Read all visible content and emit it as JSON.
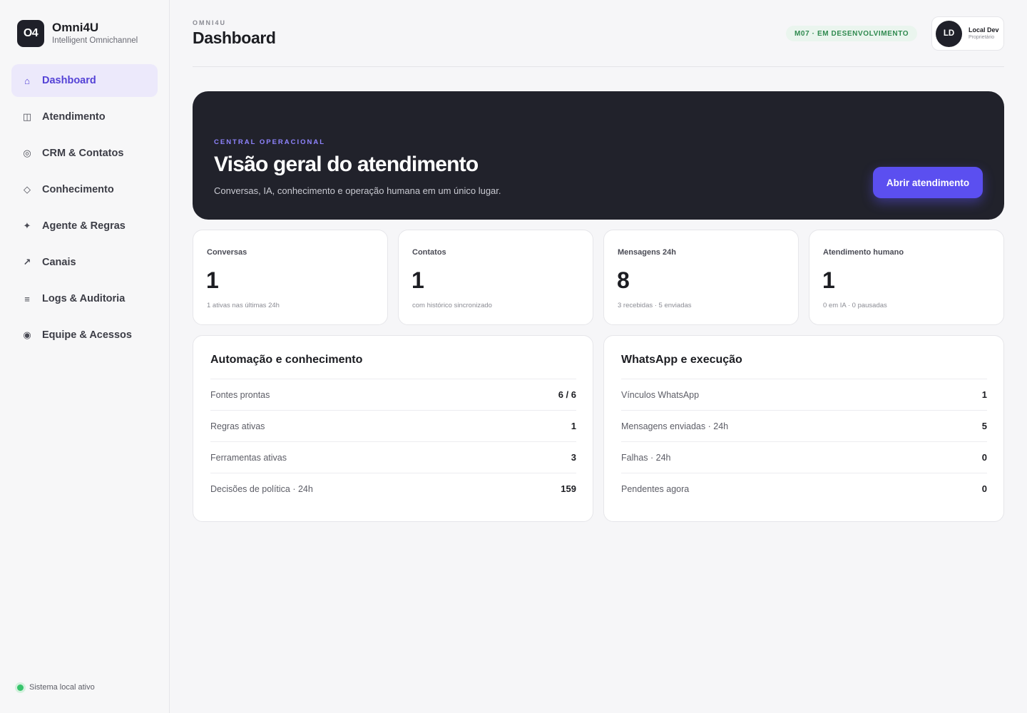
{
  "brand": {
    "logo": "O4",
    "name": "Omni4U",
    "subtitle": "Intelligent Omnichannel"
  },
  "sidebar": {
    "items": [
      {
        "label": "Dashboard",
        "icon": "home-icon",
        "glyph": "⌂",
        "active": true
      },
      {
        "label": "Atendimento",
        "icon": "columns-icon",
        "glyph": "◫",
        "active": false
      },
      {
        "label": "CRM & Contatos",
        "icon": "target-icon",
        "glyph": "◎",
        "active": false
      },
      {
        "label": "Conhecimento",
        "icon": "diamond-icon",
        "glyph": "◇",
        "active": false
      },
      {
        "label": "Agente & Regras",
        "icon": "sparkle-icon",
        "glyph": "✦",
        "active": false
      },
      {
        "label": "Canais",
        "icon": "arrow-up-right-icon",
        "glyph": "↗",
        "active": false
      },
      {
        "label": "Logs & Auditoria",
        "icon": "list-icon",
        "glyph": "≡",
        "active": false
      },
      {
        "label": "Equipe & Acessos",
        "icon": "circle-dot-icon",
        "glyph": "◉",
        "active": false
      }
    ],
    "status": "Sistema local ativo"
  },
  "header": {
    "eyebrow": "OMNI4U",
    "title": "Dashboard",
    "env_badge": "M07 · EM DESENVOLVIMENTO",
    "user": {
      "initials": "LD",
      "name": "Local Dev",
      "role": "Proprietário"
    }
  },
  "hero": {
    "eyebrow": "CENTRAL OPERACIONAL",
    "title": "Visão geral do atendimento",
    "subtitle": "Conversas, IA, conhecimento e operação humana em um único lugar.",
    "button": "Abrir atendimento"
  },
  "stats": [
    {
      "label": "Conversas",
      "value": "1",
      "note": "1 ativas nas últimas 24h"
    },
    {
      "label": "Contatos",
      "value": "1",
      "note": "com histórico sincronizado"
    },
    {
      "label": "Mensagens 24h",
      "value": "8",
      "note": "3 recebidas · 5 enviadas"
    },
    {
      "label": "Atendimento humano",
      "value": "1",
      "note": "0 em IA · 0 pausadas"
    }
  ],
  "panels": [
    {
      "title": "Automação e conhecimento",
      "rows": [
        {
          "label": "Fontes prontas",
          "value": "6 / 6"
        },
        {
          "label": "Regras ativas",
          "value": "1"
        },
        {
          "label": "Ferramentas ativas",
          "value": "3"
        },
        {
          "label": "Decisões de política · 24h",
          "value": "159"
        }
      ]
    },
    {
      "title": "WhatsApp e execução",
      "rows": [
        {
          "label": "Vínculos WhatsApp",
          "value": "1"
        },
        {
          "label": "Mensagens enviadas · 24h",
          "value": "5"
        },
        {
          "label": "Falhas · 24h",
          "value": "0"
        },
        {
          "label": "Pendentes agora",
          "value": "0"
        }
      ]
    }
  ],
  "colors": {
    "accent": "#5b4ff0",
    "active_nav_bg": "#ece9fb",
    "hero_bg": "#21222b",
    "status_green": "#37c46c",
    "badge_bg": "#eaf5ee",
    "badge_text": "#2f8a4f"
  }
}
